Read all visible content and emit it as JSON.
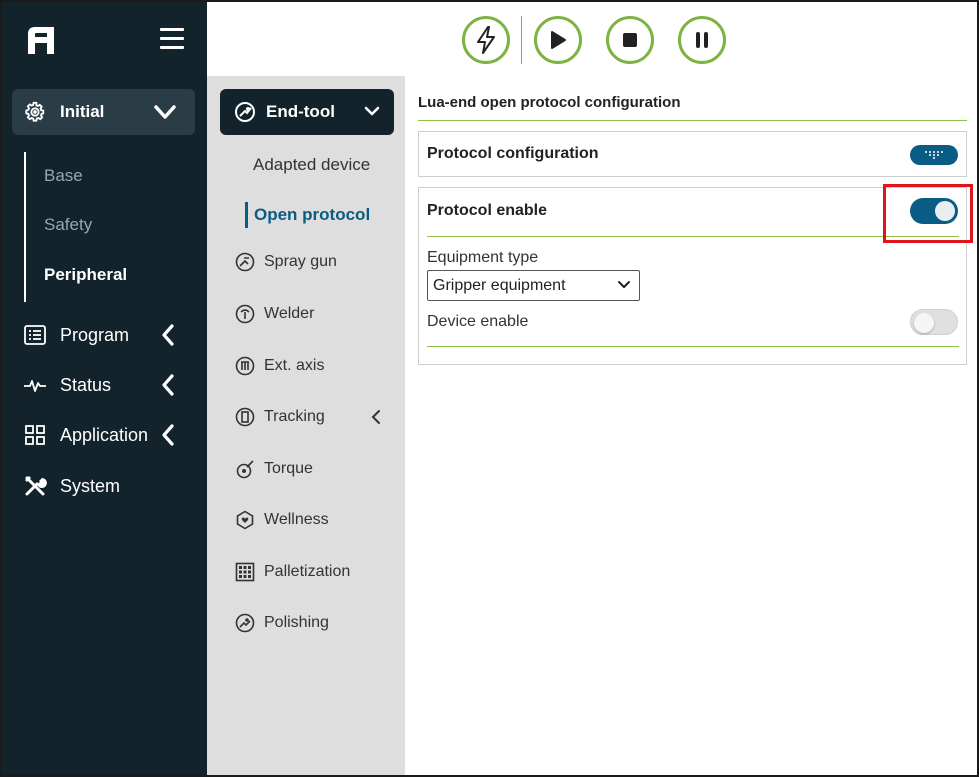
{
  "sidebar": {
    "logo_icon": "logo-icon",
    "menu_icon": "hamburger-icon",
    "initial": {
      "label": "Initial",
      "icon": "gear-icon"
    },
    "sub_items": [
      {
        "label": "Base"
      },
      {
        "label": "Safety"
      },
      {
        "label": "Peripheral"
      }
    ],
    "nav": [
      {
        "label": "Program",
        "icon": "program-list-icon"
      },
      {
        "label": "Status",
        "icon": "pulse-icon"
      },
      {
        "label": "Application",
        "icon": "grid-icon"
      },
      {
        "label": "System",
        "icon": "tools-icon"
      }
    ]
  },
  "toolbar": {
    "buttons": [
      "power-bolt-icon",
      "play-icon",
      "stop-icon",
      "pause-icon"
    ],
    "accent": "#7cb342"
  },
  "subnav": {
    "header": {
      "label": "End-tool"
    },
    "adapted_device": "Adapted device",
    "open_protocol": "Open protocol",
    "tools": [
      {
        "label": "Spray gun"
      },
      {
        "label": "Welder"
      },
      {
        "label": "Ext. axis"
      },
      {
        "label": "Tracking"
      },
      {
        "label": "Torque"
      },
      {
        "label": "Wellness"
      },
      {
        "label": "Palletization"
      },
      {
        "label": "Polishing"
      }
    ]
  },
  "main": {
    "title": "Lua-end open protocol configuration",
    "protocol_config": {
      "label": "Protocol configuration"
    },
    "protocol_enable": {
      "label": "Protocol enable",
      "enabled": true
    },
    "equipment_type": {
      "label": "Equipment type",
      "value": "Gripper equipment"
    },
    "device_enable": {
      "label": "Device enable",
      "enabled": false
    }
  },
  "colors": {
    "sidebar_bg": "#13232c",
    "primary_blue": "#0a5c84",
    "green_line": "#8bc34a",
    "highlight_red": "#e0151b"
  }
}
